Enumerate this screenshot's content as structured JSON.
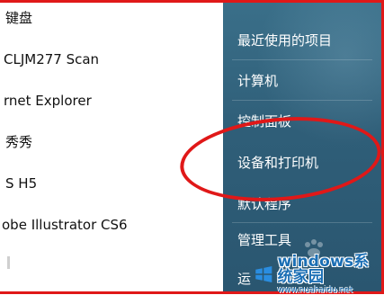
{
  "programs": [
    {
      "label": "键盘"
    },
    {
      "label": "CLJM277 Scan"
    },
    {
      "label": "rnet Explorer"
    },
    {
      "label": "秀秀"
    },
    {
      "label": "S H5"
    },
    {
      "label": "obe Illustrator CS6"
    }
  ],
  "start_menu": {
    "items": [
      {
        "label": "最近使用的项目"
      },
      {
        "label": "计算机"
      },
      {
        "label": "控制面板"
      },
      {
        "label": "设备和打印机"
      },
      {
        "label": "默认程序"
      },
      {
        "label": "管理工具"
      },
      {
        "label": "运"
      }
    ]
  },
  "watermark": {
    "title": "windows系统家园",
    "subtitle": "www.nuahaidu.net"
  },
  "colors": {
    "highlight": "#e01818",
    "menu_bg": "#2f5e78",
    "watermark": "#1b6fb5"
  }
}
